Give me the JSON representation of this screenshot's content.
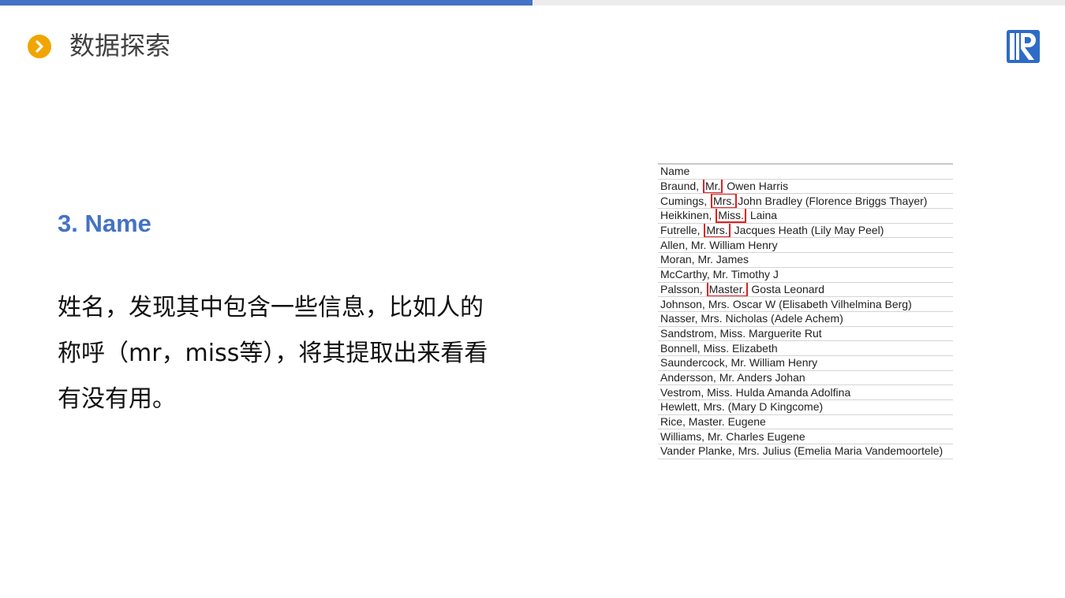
{
  "progress": 0.5,
  "header": {
    "icon": "chevron-right-icon",
    "title": "数据探索",
    "logo": "R-logo"
  },
  "section": {
    "title": "3. Name",
    "description_lines": [
      "姓名，发现其中包含一些信息，比如人的",
      "称呼（mr，miss等），将其提取出来看看",
      "有没有用。"
    ]
  },
  "table": {
    "header": "Name",
    "rows": [
      {
        "before": "Braund, ",
        "title": "Mr.",
        "after": " Owen Harris",
        "highlight": true
      },
      {
        "before": "Cumings, ",
        "title": "Mrs.",
        "after": "John Bradley (Florence Briggs Thayer)",
        "highlight": true
      },
      {
        "before": "Heikkinen, ",
        "title": "Miss.",
        "after": " Laina",
        "highlight": true
      },
      {
        "before": "Futrelle, ",
        "title": "Mrs.",
        "after": " Jacques Heath (Lily May Peel)",
        "highlight": true
      },
      {
        "before": "Allen, Mr. William Henry",
        "title": "",
        "after": "",
        "highlight": false
      },
      {
        "before": "Moran, Mr. James",
        "title": "",
        "after": "",
        "highlight": false
      },
      {
        "before": "McCarthy, Mr. Timothy J",
        "title": "",
        "after": "",
        "highlight": false
      },
      {
        "before": "Palsson, ",
        "title": "Master.",
        "after": " Gosta Leonard",
        "highlight": true
      },
      {
        "before": "Johnson, Mrs. Oscar W (Elisabeth Vilhelmina Berg)",
        "title": "",
        "after": "",
        "highlight": false
      },
      {
        "before": "Nasser, Mrs. Nicholas (Adele Achem)",
        "title": "",
        "after": "",
        "highlight": false
      },
      {
        "before": "Sandstrom, Miss. Marguerite Rut",
        "title": "",
        "after": "",
        "highlight": false
      },
      {
        "before": "Bonnell, Miss. Elizabeth",
        "title": "",
        "after": "",
        "highlight": false
      },
      {
        "before": "Saundercock, Mr. William Henry",
        "title": "",
        "after": "",
        "highlight": false
      },
      {
        "before": "Andersson, Mr. Anders Johan",
        "title": "",
        "after": "",
        "highlight": false
      },
      {
        "before": "Vestrom, Miss. Hulda Amanda Adolfina",
        "title": "",
        "after": "",
        "highlight": false
      },
      {
        "before": "Hewlett, Mrs. (Mary D Kingcome)",
        "title": "",
        "after": "",
        "highlight": false
      },
      {
        "before": "Rice, Master. Eugene",
        "title": "",
        "after": "",
        "highlight": false
      },
      {
        "before": "Williams, Mr. Charles Eugene",
        "title": "",
        "after": "",
        "highlight": false
      },
      {
        "before": "Vander Planke, Mrs. Julius (Emelia Maria Vandemoortele)",
        "title": "",
        "after": "",
        "highlight": false
      }
    ]
  },
  "colors": {
    "accent": "#4472c4",
    "icon_bg": "#f0a500",
    "highlight_border": "#e02020"
  }
}
